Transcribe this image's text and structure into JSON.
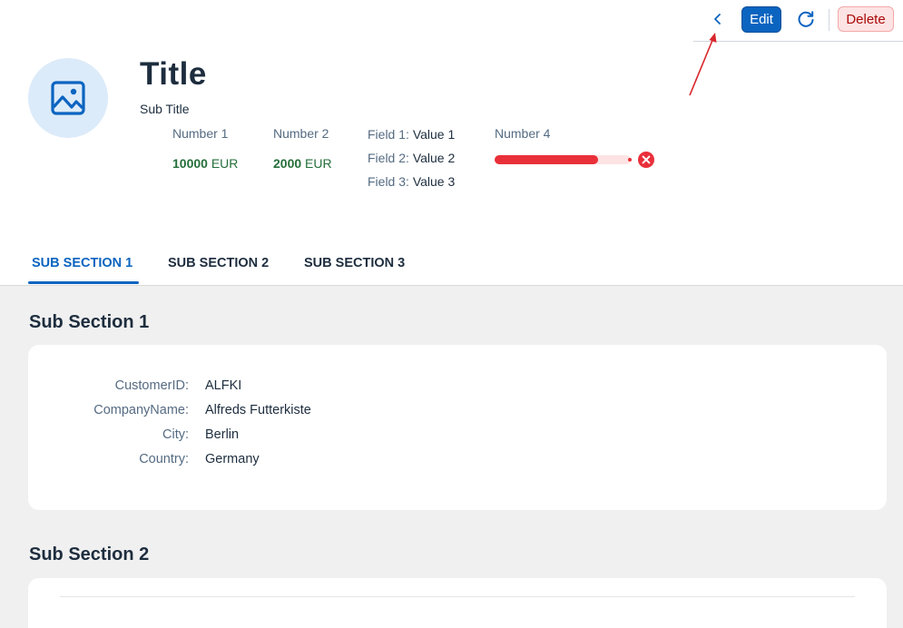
{
  "toolbar": {
    "edit_label": "Edit",
    "delete_label": "Delete"
  },
  "header": {
    "title": "Title",
    "subtitle": "Sub Title",
    "kpis": [
      {
        "label": "Number 1",
        "value": "10000",
        "unit": "EUR"
      },
      {
        "label": "Number 2",
        "value": "2000",
        "unit": "EUR"
      }
    ],
    "fields": [
      {
        "label": "Field 1:",
        "value": "Value 1"
      },
      {
        "label": "Field 2:",
        "value": "Value 2"
      },
      {
        "label": "Field 3:",
        "value": "Value 3"
      }
    ],
    "progress": {
      "label": "Number 4",
      "fraction": 0.76,
      "status": "error",
      "color": "#e9303a"
    }
  },
  "tabs": [
    {
      "label": "SUB SECTION 1",
      "active": true
    },
    {
      "label": "SUB SECTION 2",
      "active": false
    },
    {
      "label": "SUB SECTION 3",
      "active": false
    }
  ],
  "sections": [
    {
      "title": "Sub Section 1",
      "form": [
        {
          "label": "CustomerID:",
          "value": "ALFKI"
        },
        {
          "label": "CompanyName:",
          "value": "Alfreds Futterkiste"
        },
        {
          "label": "City:",
          "value": "Berlin"
        },
        {
          "label": "Country:",
          "value": "Germany"
        }
      ]
    },
    {
      "title": "Sub Section 2"
    }
  ],
  "icons": {
    "back": "chevron-left-icon",
    "refresh": "refresh-icon",
    "avatar": "image-icon",
    "error": "error-icon"
  },
  "colors": {
    "accent": "#0b64c0",
    "positive": "#256f3a",
    "negative": "#e9303a",
    "annotation_arrow": "#d9262c"
  }
}
